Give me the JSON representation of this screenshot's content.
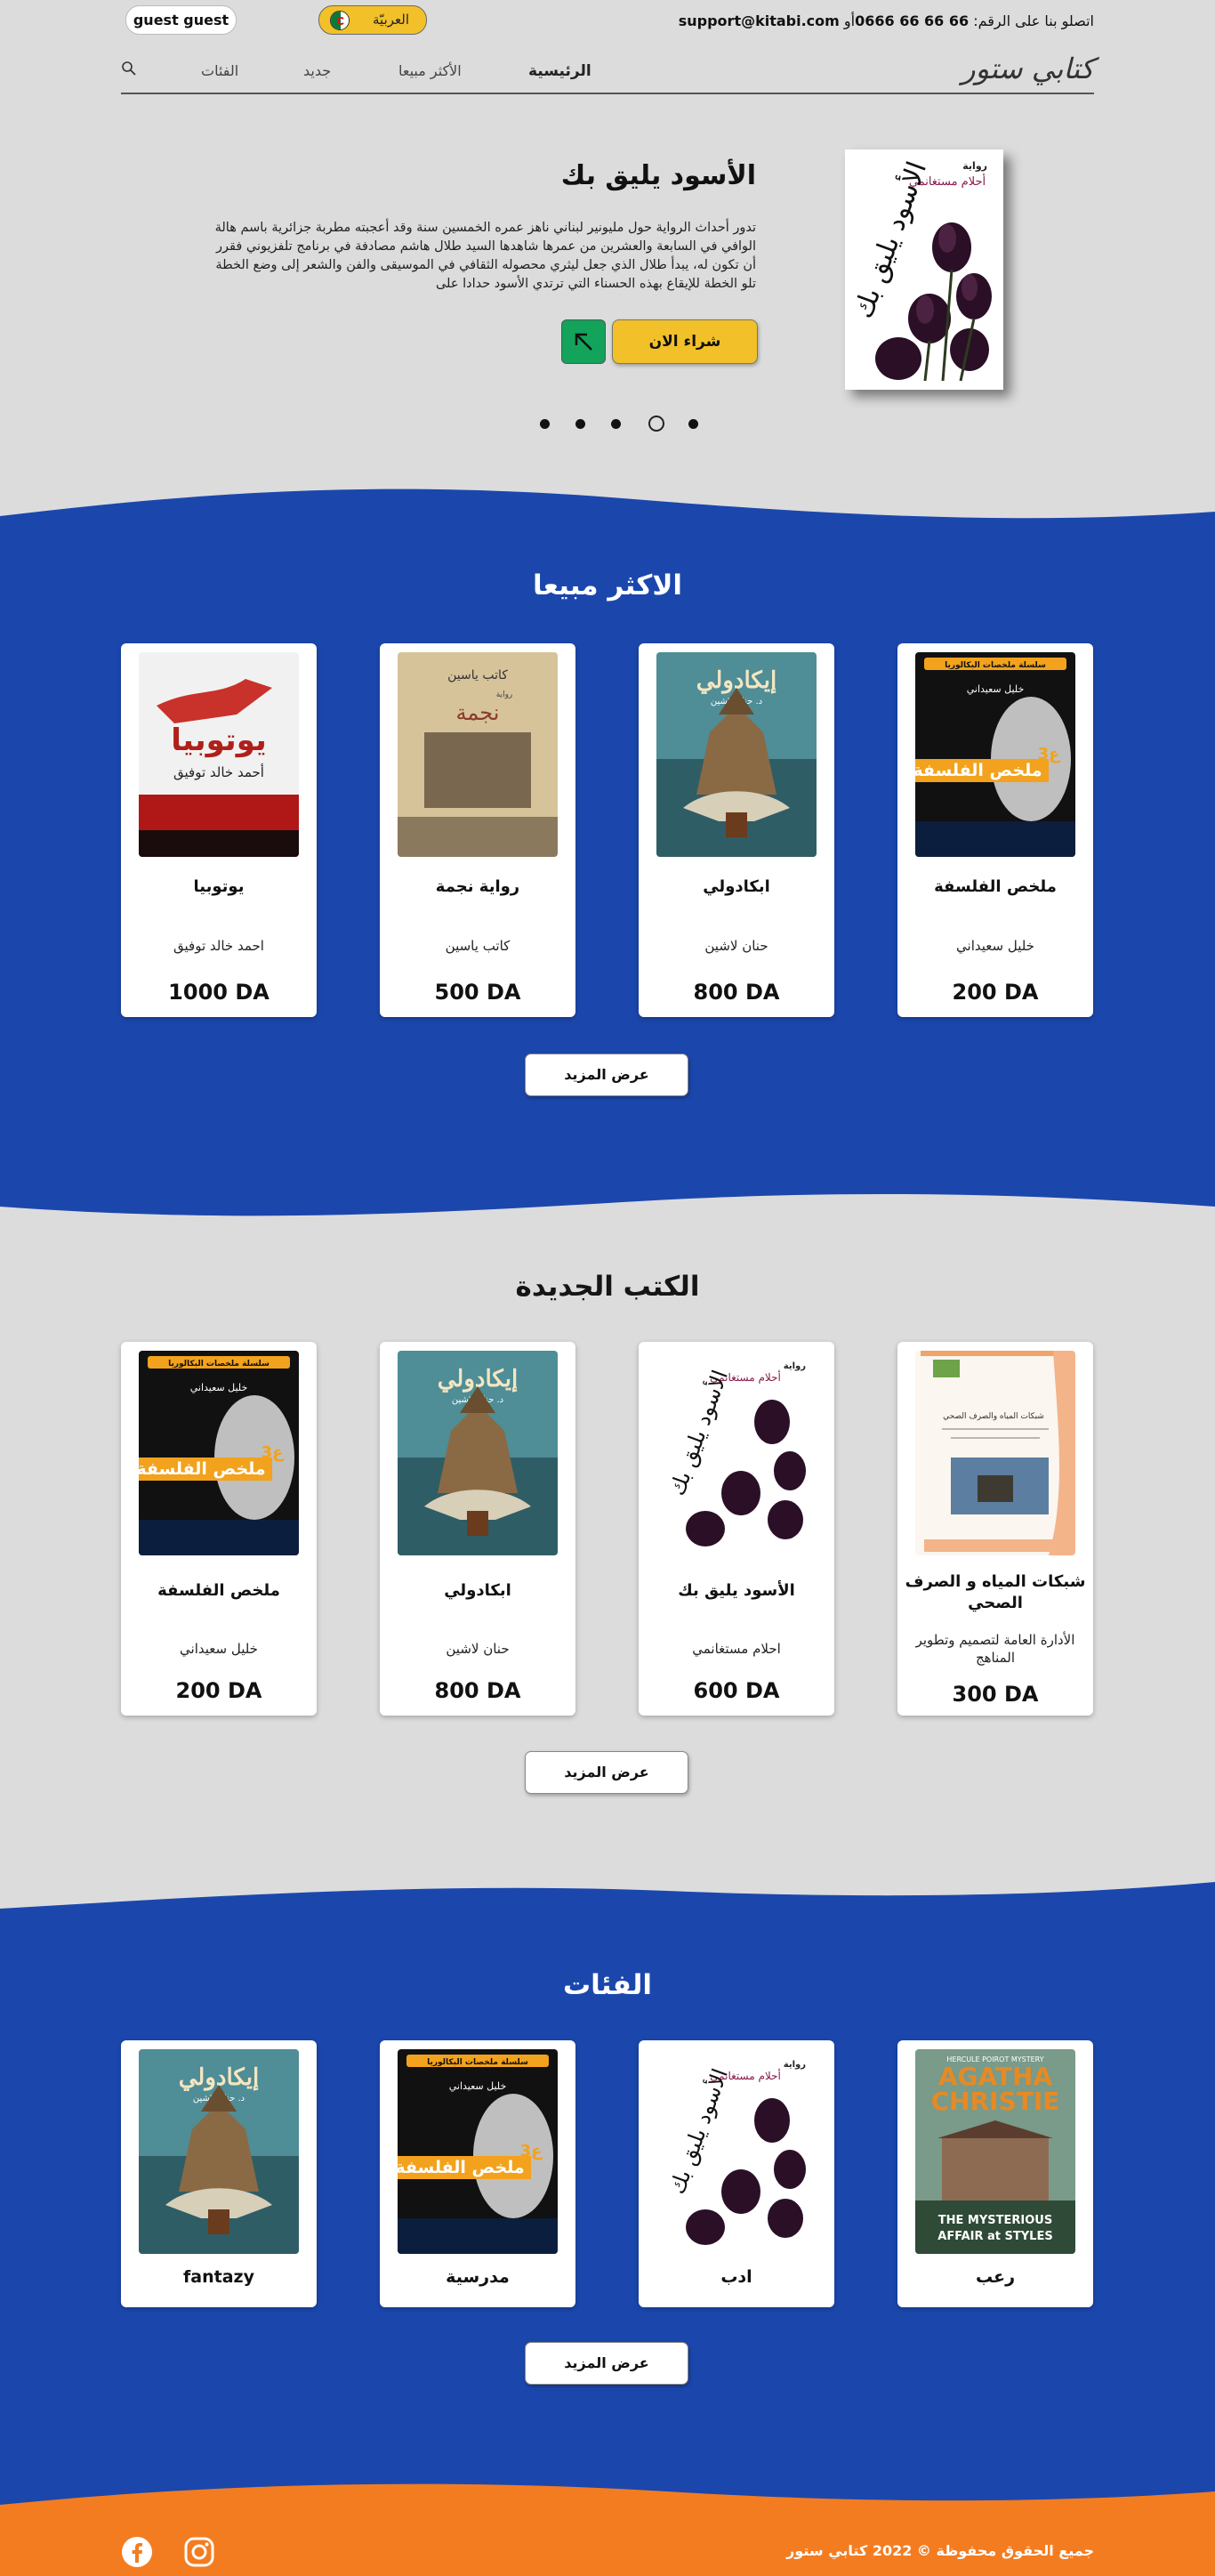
{
  "header": {
    "user_label": "guest guest",
    "language_label": "العربيّة",
    "contact_prefix": "اتصلو بنا على الرقم:",
    "phone": "0666 66 66 66",
    "contact_or": "أو",
    "email": "support@kitabi.com"
  },
  "nav": {
    "brand": "كتابي ستور",
    "items": [
      "الرئيسية",
      "الأكثر مبيعا",
      "جديد",
      "الفئات"
    ]
  },
  "hero": {
    "title": "الأسود يليق بك",
    "description": "تدور أحداث الرواية حول مليونير لبناني ناهز عمره الخمسين سنة وقد أعجبته مطربة جزائرية باسم هالة الوافي في السابعة والعشرين من عمرها شاهدها السيد طلال هاشم مصادفة في برنامج تلفزيوني فقرر أن تكون له، يبدأ طلال الذي جعل ليثري محصوله الثقافي في الموسيقى والفن والشعر إلى وضع الخطة تلو الخطة للإيقاع بهذه الحسناء التي ترتدي الأسود حدادا على",
    "buy_label": "شراء الان",
    "cover_badge": "رواية",
    "cover_author": "أحلام مستغانمي",
    "cover_title": "الأسود يليق بك",
    "slides": 5,
    "active_slide": 2
  },
  "bestsellers": {
    "title": "الاكثر مبيعا",
    "more_label": "عرض المزيد",
    "items": [
      {
        "name": "ملخص الفلسفة",
        "author": "خليل سعيداني",
        "price": "200 DA",
        "cover": "philosophy"
      },
      {
        "name": "ابكادولي",
        "author": "حنان لاشين",
        "price": "800 DA",
        "cover": "ikadoli"
      },
      {
        "name": "رواية نجمة",
        "author": "كاتب ياسين",
        "price": "500 DA",
        "cover": "nedjma"
      },
      {
        "name": "يوتوبيا",
        "author": "احمد خالد توفيق",
        "price": "1000 DA",
        "cover": "utopia"
      }
    ]
  },
  "new_books": {
    "title": "الكتب الجديدة",
    "more_label": "عرض المزيد",
    "items": [
      {
        "name": "شبكات المياه و الصرف الصحي",
        "author": "الأدارة العامة لتصميم وتطوير المناهج",
        "price": "300 DA",
        "cover": "water"
      },
      {
        "name": "الأسود يليق بك",
        "author": "احلام مستغانمي",
        "price": "600 DA",
        "cover": "aswad"
      },
      {
        "name": "ابكادولي",
        "author": "حنان لاشين",
        "price": "800 DA",
        "cover": "ikadoli"
      },
      {
        "name": "ملخص الفلسفة",
        "author": "خليل سعيداني",
        "price": "200 DA",
        "cover": "philosophy"
      }
    ]
  },
  "categories": {
    "title": "الفئات",
    "more_label": "عرض المزيد",
    "items": [
      {
        "name": "رعب",
        "cover": "christie"
      },
      {
        "name": "ادب",
        "cover": "aswad"
      },
      {
        "name": "مدرسية",
        "cover": "philosophy"
      },
      {
        "name": "fantazy",
        "cover": "ikadoli"
      }
    ]
  },
  "covers": {
    "philosophy": {
      "badge": "سلسلة ملخصات البكالوريا",
      "author": "خليل سعيداني",
      "title": "ملخص الفلسفة",
      "tag": "3ع"
    },
    "ikadoli": {
      "title": "إيكادولي",
      "author": "د. حنان لاشين"
    },
    "nedjma": {
      "author": "كاتب ياسين",
      "kind": "رواية",
      "title": "نجمة"
    },
    "utopia": {
      "title": "يوتوبيا",
      "author": "أحمد خالد توفيق"
    },
    "aswad": {
      "badge": "رواية",
      "author": "أحلام مستغانمي",
      "title": "الأسود يليق بك"
    },
    "water": {
      "title": "شبكات المياه والصرف الصحي"
    },
    "christie": {
      "top": "HERCULE POIROT MYSTERY",
      "author_line1": "AGATHA",
      "author_line2": "CHRISTIE",
      "title_line1": "THE MYSTERIOUS",
      "title_line2": "AFFAIR at STYLES"
    }
  },
  "footer": {
    "copyright": "جميع الحقوق محفوظة © 2022 كتابي ستور",
    "social": [
      "facebook-icon",
      "instagram-icon"
    ]
  },
  "colors": {
    "blue": "#1b47ad",
    "yellow": "#f2c028",
    "green": "#13a35a",
    "orange": "#f47c20",
    "background": "#dcdcdc"
  }
}
